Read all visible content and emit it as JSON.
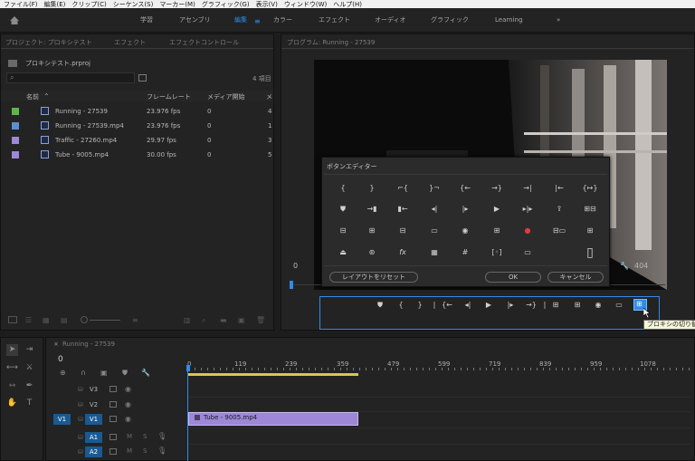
{
  "menubar": [
    "ファイル(F)",
    "編集(E)",
    "クリップ(C)",
    "シーケンス(S)",
    "マーカー(M)",
    "グラフィック(G)",
    "表示(V)",
    "ウィンドウ(W)",
    "ヘルプ(H)"
  ],
  "workspaces": [
    "学習",
    "アセンブリ",
    "編集",
    "カラー",
    "エフェクト",
    "オーディオ",
    "グラフィック",
    "Learning"
  ],
  "workspace_active": "編集",
  "workspace_more": "»",
  "project_panel": {
    "tabs": [
      "プロジェクト: プロキシテスト",
      "エフェクト",
      "エフェクトコントロール"
    ],
    "project_file": "プロキシテスト.prproj",
    "item_count": "4 項目",
    "columns": [
      "名前",
      "フレームレート",
      "メディア開始",
      "メ"
    ],
    "rows": [
      {
        "name": "Running - 27539",
        "fps": "23.976 fps",
        "start": "0",
        "extra": "4",
        "swatch": "#5fb54a"
      },
      {
        "name": "Running - 27539.mp4",
        "fps": "23.976 fps",
        "start": "0",
        "extra": "1",
        "swatch": "#5b8fd4"
      },
      {
        "name": "Traffic - 27260.mp4",
        "fps": "29.97 fps",
        "start": "0",
        "extra": "3",
        "swatch": "#9d87d6"
      },
      {
        "name": "Tube - 9005.mp4",
        "fps": "30.00 fps",
        "start": "0",
        "extra": "5",
        "swatch": "#9d87d6"
      }
    ]
  },
  "program_panel": {
    "title": "プログラム: Running - 27539",
    "timecode_left": "0",
    "frame_right": "404"
  },
  "button_editor": {
    "title": "ボタンエディター",
    "reset_label": "レイアウトをリセット",
    "ok_label": "OK",
    "cancel_label": "キャンセル",
    "buttons": [
      [
        "{",
        "}",
        "⌐{",
        "}¬",
        "{←",
        "→}",
        "→|",
        "|←",
        "{↦}"
      ],
      [
        "⛊",
        "→▮",
        "▮←",
        "◂|",
        "|▸",
        "▶",
        "▸|▸",
        "⇪",
        "⊞⊟"
      ],
      [
        "⊟",
        "⊞",
        "⊟",
        "▭",
        "◉",
        "⊞",
        "●",
        "⊟▭",
        "⊞"
      ],
      [
        "⏏",
        "⊛",
        "fx",
        "▦",
        "#",
        "[◦]",
        "▭",
        "",
        "▯"
      ]
    ]
  },
  "transport": [
    "⛊",
    "{",
    "}",
    "|",
    "{←",
    "◂|",
    "▶",
    "|▸",
    "→}",
    "|",
    "⊞",
    "⊞",
    "◉",
    "▭",
    "⊞"
  ],
  "tooltip": "プロキシの切り替え",
  "timeline": {
    "tab": "Running - 27539",
    "timecode": "0",
    "ruler": [
      "0",
      "119",
      "239",
      "359",
      "479",
      "599",
      "719",
      "839",
      "959",
      "1078"
    ],
    "tracks": [
      {
        "src": "",
        "name": "V3"
      },
      {
        "src": "",
        "name": "V2"
      },
      {
        "src": "V1",
        "name": "V1"
      },
      {
        "src": "",
        "name": "A1"
      },
      {
        "src": "",
        "name": "A2"
      }
    ],
    "clip_name": "Tube - 9005.mp4",
    "colors": {
      "clip": "#9d87d6",
      "workarea": "#d8c84a",
      "accent": "#2d8ceb"
    }
  }
}
